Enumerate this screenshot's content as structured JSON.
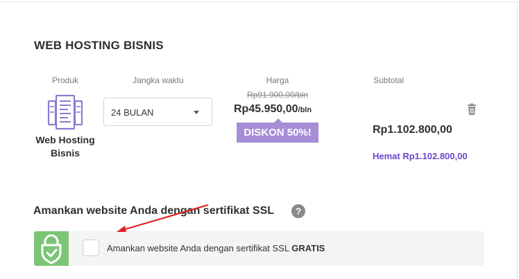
{
  "section": {
    "title": "WEB HOSTING BISNIS"
  },
  "columns": {
    "product": "Produk",
    "period": "Jangka waktu",
    "price": "Harga",
    "subtotal": "Subtotal"
  },
  "product": {
    "name": "Web Hosting Bisnis",
    "icon": "server-icon"
  },
  "period_select": {
    "value": "24 BULAN"
  },
  "pricing": {
    "old_price": "Rp91.900,00/bln",
    "price": "Rp45.950,00",
    "price_unit": "/bln",
    "discount_badge": "DISKON 50%!"
  },
  "subtotal": {
    "amount": "Rp1.102.800,00",
    "savings": "Hemat Rp1.102.800,00"
  },
  "ssl": {
    "title": "Amankan website Anda dengan sertifikat SSL",
    "help": "?",
    "checkbox_label": "Amankan website Anda dengan sertifikat SSL",
    "checkbox_label_bold": "GRATIS",
    "checked": false
  },
  "colors": {
    "accent_purple": "#6b48c7",
    "badge_purple": "#a58ed6",
    "ssl_green": "#7cc576",
    "annotation_red": "#e02020"
  }
}
